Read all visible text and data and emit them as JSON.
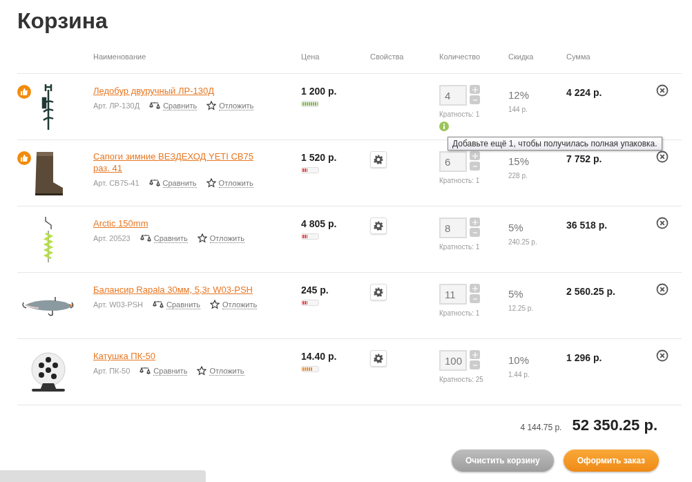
{
  "title": "Корзина",
  "columns": [
    "Наименование",
    "Цена",
    "Свойства",
    "Количество",
    "Скидка",
    "Сумма"
  ],
  "items": [
    {
      "kind": "auger",
      "recommended": true,
      "name": "Ледобур двуручный ЛР-130Д",
      "article": "Арт. ЛР-130Д",
      "compare": "Сравнить",
      "save": "Отложить",
      "price": "1 200 р.",
      "level": 1.0,
      "has_properties": false,
      "quantity": "4",
      "multiplicity": "Кратность: 1",
      "info": true,
      "discount": "12%",
      "discount_sum": "144 р.",
      "sum": "4 224 р."
    },
    {
      "kind": "boot",
      "recommended": true,
      "name": "Сапоги зимние ВЕЗДЕХОД YETI СВ75 раз. 41",
      "article": "Арт. СВ75-41",
      "compare": "Сравнить",
      "save": "Отложить",
      "price": "1 520 р.",
      "level": 0.33,
      "has_properties": true,
      "quantity": "6",
      "multiplicity": "Кратность: 1",
      "info": false,
      "discount": "15%",
      "discount_sum": "228 р.",
      "sum": "7 752 р."
    },
    {
      "kind": "drill",
      "recommended": false,
      "name": "Arctic 150mm",
      "article": "Арт. 20523",
      "compare": "Сравнить",
      "save": "Отложить",
      "price": "4 805 р.",
      "level": 0.33,
      "has_properties": true,
      "quantity": "8",
      "multiplicity": "Кратность: 1",
      "info": false,
      "discount": "5%",
      "discount_sum": "240.25 р.",
      "sum": "36 518 р."
    },
    {
      "kind": "lure",
      "recommended": false,
      "name": "Балансир Rapala 30мм, 5,3г W03-PSH",
      "article": "Арт. W03-PSH",
      "compare": "Сравнить",
      "save": "Отложить",
      "price": "245 р.",
      "level": 0.33,
      "has_properties": true,
      "quantity": "11",
      "multiplicity": "Кратность: 1",
      "info": false,
      "discount": "5%",
      "discount_sum": "12.25 р.",
      "sum": "2 560.25 р."
    },
    {
      "kind": "reel",
      "recommended": false,
      "name": "Катушка ПК-50",
      "article": "Арт. ПК-50",
      "compare": "Сравнить",
      "save": "Отложить",
      "price": "14.40 р.",
      "level": 0.67,
      "has_properties": true,
      "quantity": "100",
      "multiplicity": "Кратность: 25",
      "info": false,
      "discount": "10%",
      "discount_sum": "1.44 р.",
      "sum": "1 296 р."
    }
  ],
  "tooltip": "Добавьте ещё 1, чтобы получилась полная упаковка.",
  "total_discount": "4 144.75 р.",
  "total": "52 350.25 р.",
  "buttons": [
    {
      "kind": "secondary",
      "label": "Очистить корзину"
    },
    {
      "kind": "primary",
      "label": "Оформить заказ"
    }
  ]
}
